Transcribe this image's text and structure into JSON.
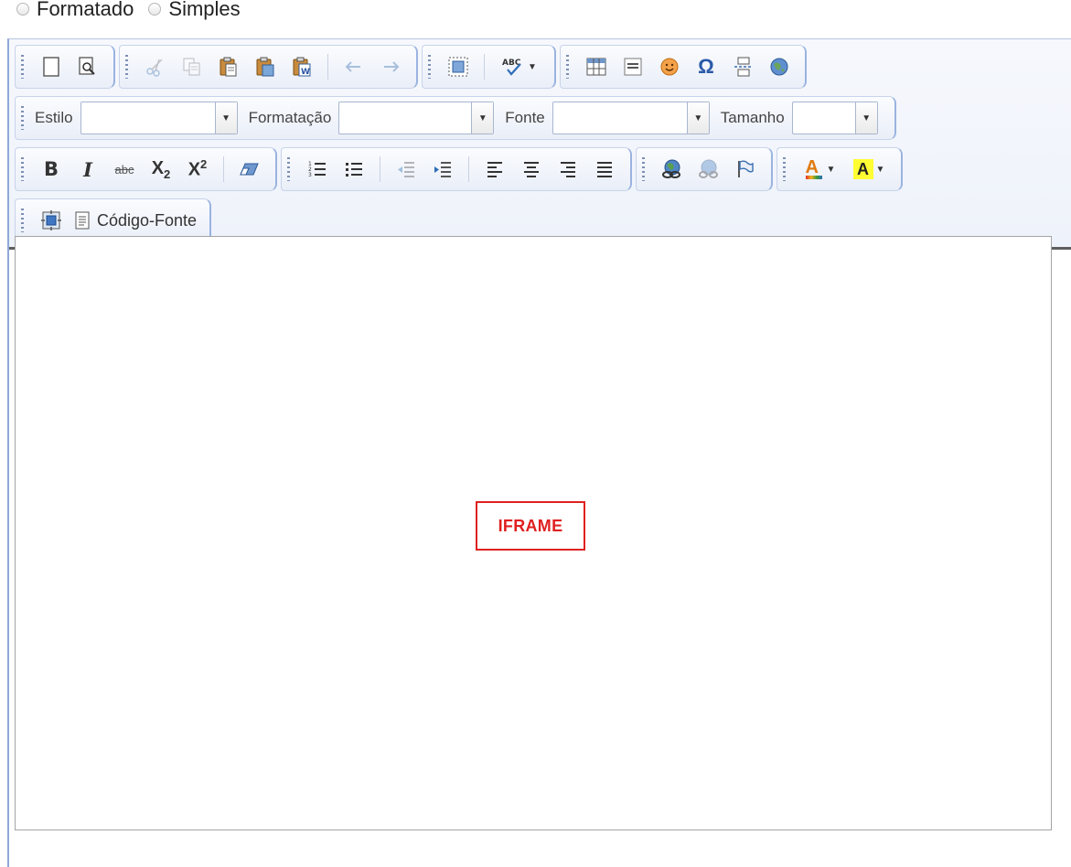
{
  "mode": {
    "options": [
      {
        "label": "Formatado"
      },
      {
        "label": "Simples"
      }
    ]
  },
  "toolbar": {
    "combos": {
      "style_label": "Estilo",
      "format_label": "Formatação",
      "font_label": "Fonte",
      "size_label": "Tamanho"
    },
    "source_label": "Código-Fonte",
    "spellcheck_text": "ABC",
    "strike_text": "abc",
    "bold_text": "B",
    "italic_text": "I",
    "subscript_text": "X",
    "subscript_mark": "2",
    "superscript_text": "X",
    "superscript_mark": "2",
    "omega_text": "Ω",
    "text_color_text": "A",
    "bg_color_text": "A"
  },
  "content": {
    "placeholder_label": "IFRAME"
  },
  "colors": {
    "accent": "#9ab3e0",
    "placeholder": "#e02020",
    "highlight": "#ffff33"
  }
}
